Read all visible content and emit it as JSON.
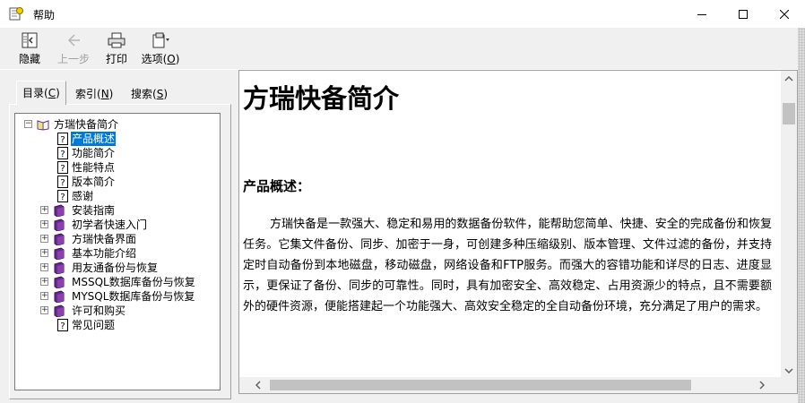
{
  "window": {
    "title": "帮助"
  },
  "toolbar": {
    "hide": "隐藏",
    "back": "上一步",
    "print": "打印",
    "options": "选项(",
    "options_key": "O",
    "options_close": ")"
  },
  "tabs": [
    {
      "label": "目录(",
      "key": "C",
      "close": ")"
    },
    {
      "label": "索引(",
      "key": "N",
      "close": ")"
    },
    {
      "label": "搜索(",
      "key": "S",
      "close": ")"
    }
  ],
  "tree": {
    "root": "方瑞快备简介",
    "root_children": [
      "产品概述",
      "功能简介",
      "性能特点",
      "版本简介",
      "感谢"
    ],
    "books": [
      "安装指南",
      "初学者快速入门",
      "方瑞快备界面",
      "基本功能介绍",
      "用友通备份与恢复",
      "MSSQL数据库备份与恢复",
      "MYSQL数据库备份与恢复",
      "许可和购买"
    ],
    "last_page": "常见问题"
  },
  "content": {
    "title": "方瑞快备简介",
    "section": "产品概述：",
    "paragraph": "方瑞快备是一款强大、稳定和易用的数据备份软件，能帮助您简单、快捷、安全的完成备份和恢复任务。它集文件备份、同步、加密于一身，可创建多种压缩级别、版本管理、文件过滤的备份，并支持定时自动备份到本地磁盘，移动磁盘，网络设备和FTP服务。而强大的容错功能和详尽的日志、进度显示，更保证了备份、同步的可靠性。同时，具有加密安全、高效稳定、占用资源少的特点，且不需要额外的硬件资源，便能搭建起一个功能强大、高效安全稳定的全自动备份环境，充分满足了用户的需求。"
  }
}
